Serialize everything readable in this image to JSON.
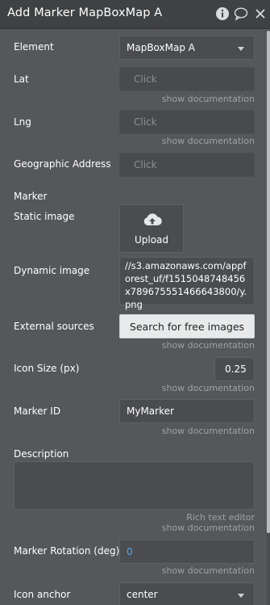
{
  "header": {
    "title": "Add Marker MapBoxMap A"
  },
  "icons": {
    "info": "info-icon",
    "comment": "comment-icon",
    "close": "close-icon"
  },
  "fields": {
    "element": {
      "label": "Element",
      "value": "MapBoxMap A"
    },
    "lat": {
      "label": "Lat",
      "placeholder": "Click",
      "doc": "show documentation"
    },
    "lng": {
      "label": "Lng",
      "placeholder": "Click",
      "doc": "show documentation"
    },
    "geo": {
      "label": "Geographic Address",
      "placeholder": "Click"
    },
    "marker_section": "Marker",
    "static_image": {
      "label": "Static image",
      "button": "Upload"
    },
    "dynamic_image": {
      "label": "Dynamic image",
      "value": "//s3.amazonaws.com/appforest_uf/f1515048748456x789675551466643800/y.png"
    },
    "external": {
      "label": "External sources",
      "button": "Search for free images",
      "doc": "show documentation"
    },
    "icon_size": {
      "label": "Icon Size (px)",
      "value": "0.25",
      "doc": "show documentation"
    },
    "marker_id": {
      "label": "Marker ID",
      "value": "MyMarker",
      "doc": "show documentation"
    },
    "description": {
      "label": "Description",
      "rich": "Rich text editor",
      "doc": "show documentation"
    },
    "rotation": {
      "label": "Marker Rotation (deg)",
      "value": "0",
      "doc": "show documentation"
    },
    "anchor": {
      "label": "Icon anchor",
      "value": "center"
    }
  },
  "colors": {
    "panel_bg": "#55575a",
    "header_bg": "#3f4143",
    "accent_blue": "#5aa3ea"
  }
}
